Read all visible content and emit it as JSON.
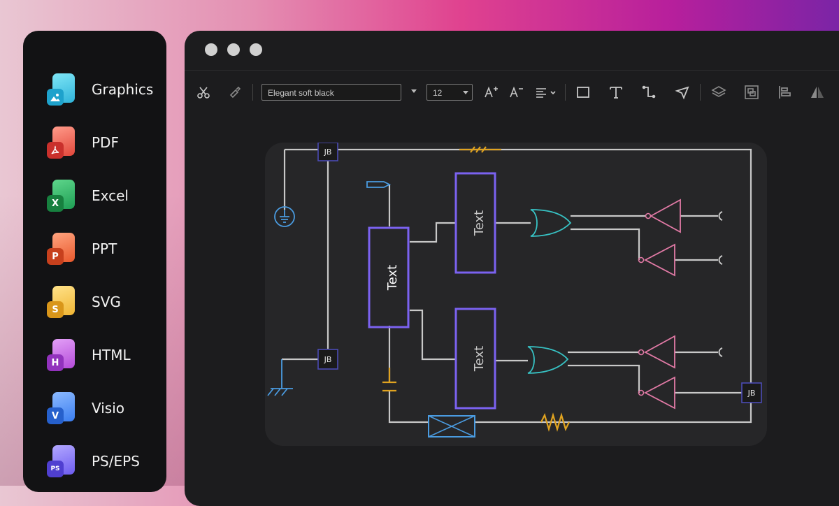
{
  "sidebar": {
    "items": [
      {
        "label": "Graphics",
        "icon": "graphics-file-icon",
        "color": "#3cc7e6",
        "badge": ""
      },
      {
        "label": "PDF",
        "icon": "pdf-file-icon",
        "color": "#e2473b",
        "badge": ""
      },
      {
        "label": "Excel",
        "icon": "excel-file-icon",
        "color": "#1e9e54",
        "badge": "X"
      },
      {
        "label": "PPT",
        "icon": "ppt-file-icon",
        "color": "#e9582c",
        "badge": "P"
      },
      {
        "label": "SVG",
        "icon": "svg-file-icon",
        "color": "#f0b533",
        "badge": "S"
      },
      {
        "label": "HTML",
        "icon": "html-file-icon",
        "color": "#b44bd9",
        "badge": "H"
      },
      {
        "label": "Visio",
        "icon": "visio-file-icon",
        "color": "#3a7df0",
        "badge": "V"
      },
      {
        "label": "PS/EPS",
        "icon": "ps-eps-file-icon",
        "color": "#6d5cf0",
        "badge": "PS"
      }
    ]
  },
  "toolbar": {
    "font_family": "Elegant soft black",
    "font_size": "12",
    "icons": [
      "cut-icon",
      "format-painter-icon",
      "increase-font-icon",
      "decrease-font-icon",
      "align-icon",
      "rectangle-icon",
      "text-tool-icon",
      "connector-icon",
      "pointer-icon",
      "layers-icon",
      "group-icon",
      "align-left-icon",
      "flip-icon"
    ]
  },
  "diagram": {
    "block_labels": [
      "Text",
      "Text",
      "Text"
    ],
    "junction_labels": [
      "JB",
      "JB",
      "JB"
    ],
    "colors": {
      "wire": "#c8c8c8",
      "block": "#7b62f0",
      "or_gate": "#37c2c4",
      "inverter": "#e27aa6",
      "ground": "#4a9be0",
      "resistor": "#e0a320",
      "junction_border": "#4b4bb5"
    }
  }
}
